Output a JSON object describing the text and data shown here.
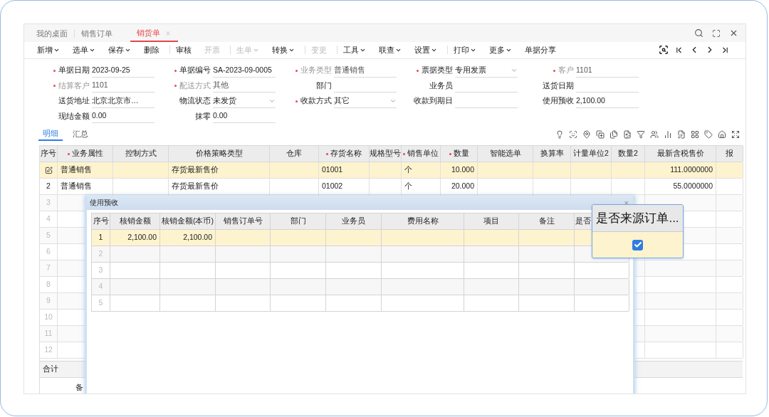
{
  "tabs": [
    {
      "label": "我的桌面",
      "selected": false,
      "closable": false
    },
    {
      "label": "销售订单",
      "selected": false,
      "closable": false
    },
    {
      "label": "销货单",
      "selected": true,
      "closable": true
    }
  ],
  "toolbar": [
    {
      "kind": "button",
      "label": "新增",
      "dropdown": true,
      "disabled": false
    },
    {
      "kind": "button",
      "label": "选单",
      "dropdown": true,
      "disabled": false
    },
    {
      "kind": "button",
      "label": "保存",
      "dropdown": true,
      "disabled": false
    },
    {
      "kind": "button",
      "label": "删除",
      "dropdown": false,
      "disabled": false
    },
    {
      "kind": "separator"
    },
    {
      "kind": "button",
      "label": "审核",
      "dropdown": false,
      "disabled": false
    },
    {
      "kind": "button",
      "label": "开票",
      "dropdown": false,
      "disabled": true
    },
    {
      "kind": "separator"
    },
    {
      "kind": "button",
      "label": "生单",
      "dropdown": true,
      "disabled": true
    },
    {
      "kind": "button",
      "label": "转换",
      "dropdown": true,
      "disabled": false
    },
    {
      "kind": "separator"
    },
    {
      "kind": "button",
      "label": "变更",
      "dropdown": false,
      "disabled": true
    },
    {
      "kind": "separator"
    },
    {
      "kind": "button",
      "label": "工具",
      "dropdown": true,
      "disabled": false
    },
    {
      "kind": "button",
      "label": "联查",
      "dropdown": true,
      "disabled": false
    },
    {
      "kind": "button",
      "label": "设置",
      "dropdown": true,
      "disabled": false
    },
    {
      "kind": "separator"
    },
    {
      "kind": "button",
      "label": "打印",
      "dropdown": true,
      "disabled": false
    },
    {
      "kind": "button",
      "label": "更多",
      "dropdown": true,
      "disabled": false
    },
    {
      "kind": "button",
      "label": "单据分享",
      "dropdown": false,
      "disabled": false
    }
  ],
  "form": [
    [
      {
        "label": "单据日期",
        "value": "2023-09-25",
        "required": true,
        "muted": false,
        "dropdown": false
      },
      {
        "label": "单据编号",
        "value": "SA-2023-09-0005",
        "required": true,
        "muted": false,
        "dropdown": false
      },
      {
        "label": "业务类型",
        "value": "普通销售",
        "required": true,
        "muted": true,
        "dropdown": false
      },
      {
        "label": "票据类型",
        "value": "专用发票",
        "required": true,
        "muted": false,
        "dropdown": true
      },
      {
        "label": "客户",
        "value": "1101",
        "required": true,
        "muted": true,
        "dropdown": false
      }
    ],
    [
      {
        "label": "结算客户",
        "value": "1101",
        "required": true,
        "muted": true,
        "dropdown": false
      },
      {
        "label": "配送方式",
        "value": "其他",
        "required": true,
        "muted": true,
        "dropdown": false
      },
      {
        "label": "部门",
        "required": false,
        "muted": false,
        "dropdown": false
      },
      {
        "label": "业务员",
        "required": false,
        "muted": false,
        "dropdown": false
      },
      {
        "label": "送货日期",
        "required": false,
        "muted": false,
        "dropdown": false
      }
    ],
    [
      {
        "label": "送货地址",
        "value": "北京北京市…",
        "required": false,
        "muted": false,
        "dropdown": false
      },
      {
        "label": "物流状态",
        "value": "未发货",
        "required": false,
        "muted": false,
        "dropdown": true
      },
      {
        "label": "收款方式",
        "value": "其它",
        "required": true,
        "muted": false,
        "dropdown": true
      },
      {
        "label": "收款到期日",
        "required": false,
        "muted": false,
        "dropdown": false
      },
      {
        "label": "使用预收",
        "value": "2,100.00",
        "required": false,
        "muted": false,
        "dropdown": false
      }
    ],
    [
      {
        "label": "现结金额",
        "value": "0.00",
        "required": false,
        "muted": false,
        "dropdown": false
      },
      {
        "label": "抹零",
        "value": "0.00",
        "required": false,
        "muted": false,
        "dropdown": false
      }
    ]
  ],
  "detail_tabs": [
    {
      "label": "明细",
      "selected": true
    },
    {
      "label": "汇总",
      "selected": false
    }
  ],
  "grid": {
    "columns": [
      {
        "label": "序号",
        "required": false
      },
      {
        "label": "业务属性",
        "required": true
      },
      {
        "label": "控制方式",
        "required": false
      },
      {
        "label": "价格策略类型",
        "required": false
      },
      {
        "label": "仓库",
        "required": false
      },
      {
        "label": "存货名称",
        "required": true
      },
      {
        "label": "规格型号",
        "required": false
      },
      {
        "label": "销售单位",
        "required": true
      },
      {
        "label": "数量",
        "required": true
      },
      {
        "label": "智能选单",
        "required": false
      },
      {
        "label": "换算率",
        "required": false
      },
      {
        "label": "计量单位2",
        "required": false
      },
      {
        "label": "数量2",
        "required": false
      },
      {
        "label": "最新含税售价",
        "required": false
      },
      {
        "label": "报",
        "required": false
      }
    ],
    "rows": [
      {
        "selected": true,
        "cells": [
          null,
          "普通销售",
          null,
          "存货最新售价",
          null,
          "01001",
          null,
          "个",
          "10.000",
          null,
          null,
          null,
          null,
          "111.0000000",
          null
        ]
      },
      {
        "selected": false,
        "cells": [
          "2",
          "普通销售",
          null,
          "存货最新售价",
          null,
          "01002",
          null,
          "个",
          "20.000",
          null,
          null,
          null,
          null,
          "55.0000000",
          null
        ]
      },
      {
        "selected": false,
        "cells": [
          "3"
        ]
      },
      {
        "selected": false,
        "cells": [
          "4"
        ]
      },
      {
        "selected": false,
        "cells": [
          "5"
        ]
      },
      {
        "selected": false,
        "cells": [
          "6"
        ]
      },
      {
        "selected": false,
        "cells": [
          "7"
        ]
      },
      {
        "selected": false,
        "cells": [
          "8"
        ]
      },
      {
        "selected": false,
        "cells": [
          "9"
        ]
      },
      {
        "selected": false,
        "cells": [
          "10"
        ]
      },
      {
        "selected": false,
        "cells": [
          "11"
        ]
      },
      {
        "selected": false,
        "cells": [
          "12"
        ]
      }
    ],
    "total_label": "合计"
  },
  "remark_label": "备",
  "dialog": {
    "title": "使用预收",
    "close": "×",
    "columns": [
      "序号",
      "核销金额",
      "核销金额(本币)",
      "销售订单号",
      "部门",
      "业务员",
      "费用名称",
      "项目",
      "备注",
      "是否"
    ],
    "rows": [
      {
        "selected": true,
        "cells": [
          "1",
          "2,100.00",
          "2,100.00"
        ]
      },
      {
        "selected": false,
        "cells": [
          "2"
        ]
      },
      {
        "selected": false,
        "cells": [
          "3"
        ]
      },
      {
        "selected": false,
        "cells": [
          "4"
        ]
      },
      {
        "selected": false,
        "cells": [
          "5"
        ]
      }
    ]
  },
  "popup": {
    "title": "是否来源订单...",
    "checked": true
  }
}
